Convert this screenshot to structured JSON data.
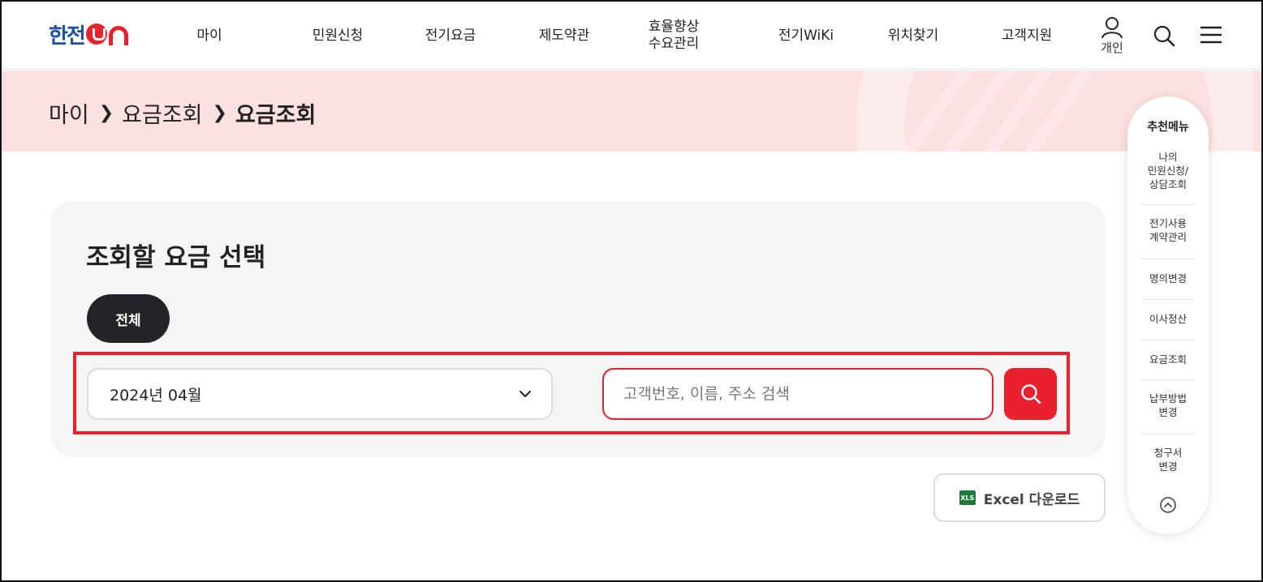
{
  "logo": {
    "text": "한전",
    "on_text": "ON"
  },
  "nav": [
    {
      "label": "마이"
    },
    {
      "label": "민원신청"
    },
    {
      "label": "전기요금"
    },
    {
      "label": "제도약관"
    },
    {
      "label_line1": "효율향상",
      "label_line2": "수요관리"
    },
    {
      "label": "전기WiKi"
    },
    {
      "label": "위치찾기"
    },
    {
      "label": "고객지원"
    }
  ],
  "header_icons": {
    "user_label": "개인",
    "user_icon": "user-icon",
    "search_icon": "search-icon",
    "menu_icon": "hamburger-menu-icon"
  },
  "breadcrumb": {
    "items": [
      "마이",
      "요금조회"
    ],
    "current": "요금조회"
  },
  "card": {
    "title": "조회할 요금 선택",
    "filter_pill": "전체",
    "month_select": {
      "value": "2024년 04월",
      "icon": "chevron-down-icon"
    },
    "search": {
      "placeholder": "고객번호, 이름, 주소 검색",
      "value": ""
    }
  },
  "excel": {
    "label": "Excel 다운로드",
    "icon_text": "XLS"
  },
  "recommend": {
    "title": "추천메뉴",
    "items": [
      "나의\n민원신청/\n상담조회",
      "전기사용\n계약관리",
      "명의변경",
      "이사정산",
      "요금조회",
      "납부방법\n변경",
      "청구서\n변경"
    ],
    "up_icon": "chevron-up-circle-icon"
  },
  "colors": {
    "brand_red": "#e8212c",
    "brand_blue": "#1d4fa3",
    "banner_bg": "#fde0e0",
    "card_bg": "#f5f5f5",
    "pill_bg": "#222428"
  }
}
